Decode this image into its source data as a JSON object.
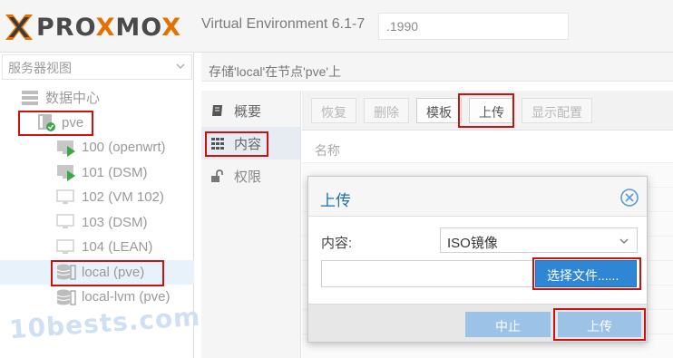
{
  "header": {
    "logo_text": "PROXMOX",
    "product": "Virtual Environment 6.1-7",
    "search_value": ".1990"
  },
  "tree": {
    "view_select": "服务器视图",
    "datacenter": "数据中心",
    "node": "pve",
    "vms": [
      "100 (openwrt)",
      "101 (DSM)",
      "102 (VM 102)",
      "103 (DSM)",
      "104 (LEAN)"
    ],
    "storages": [
      "local (pve)",
      "local-lvm (pve)"
    ]
  },
  "breadcrumb": "存储'local'在节点'pve'上",
  "subnav": {
    "items": [
      "概要",
      "内容",
      "权限"
    ]
  },
  "toolbar": {
    "restore": "恢复",
    "delete": "删除",
    "template": "模板",
    "upload": "上传",
    "show_config": "显示配置"
  },
  "grid": {
    "column_name": "名称"
  },
  "dialog": {
    "title": "上传",
    "content_label": "内容:",
    "content_value": "ISO镜像",
    "choose_file": "选择文件......",
    "cancel": "中止",
    "upload": "上传"
  },
  "watermark": "10bests.com",
  "colors": {
    "accent_orange": "#e57000",
    "dialog_title": "#1f6fa8",
    "primary_button": "#2f86d4",
    "highlight_box": "#cc1111"
  }
}
